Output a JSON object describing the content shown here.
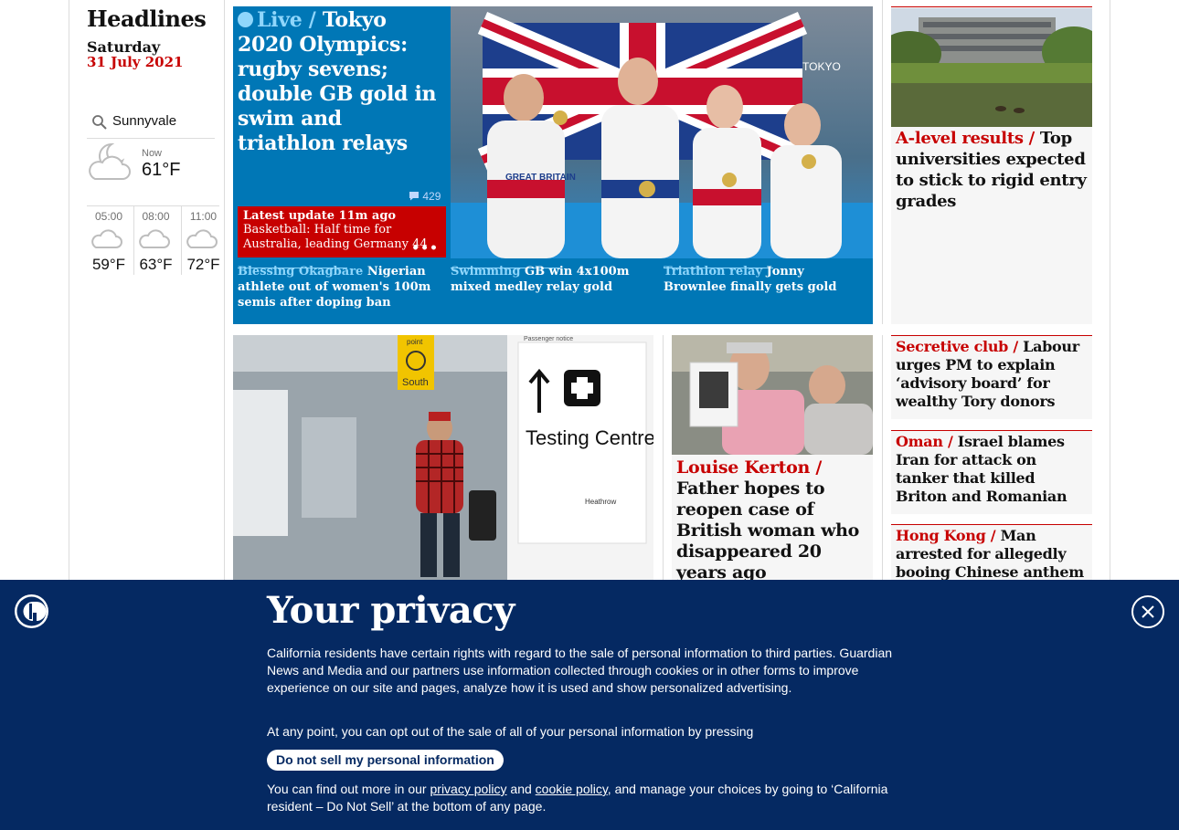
{
  "sidebar": {
    "title": "Headlines",
    "day": "Saturday",
    "date": "31 July 2021",
    "weather": {
      "location": "Sunnyvale",
      "now_label": "Now",
      "now_temp": "61°F",
      "forecast": [
        {
          "time": "05:00",
          "temp": "59°F",
          "icon": "cloud-icon"
        },
        {
          "time": "08:00",
          "temp": "63°F",
          "icon": "cloud-icon"
        },
        {
          "time": "11:00",
          "temp": "72°F",
          "icon": "cloud-icon"
        }
      ]
    }
  },
  "live": {
    "kicker": "Live /",
    "headline": "Tokyo 2020 Olympics: rugby sevens; double GB gold in swim and triathlon relays",
    "comments": "429",
    "latest_label": "Latest update 11m ago",
    "latest_text": "Basketball: Half time for Australia, leading Germany 44",
    "subs": [
      {
        "kicker": "Blessing Okagbare",
        "text": "Nigerian athlete out of women's 100m semis after doping ban"
      },
      {
        "kicker": "Swimming",
        "text": "GB win 4x100m mixed medley relay gold"
      },
      {
        "kicker": "Triathlon relay",
        "text": "Jonny Brownlee finally gets gold"
      }
    ],
    "image_text": {
      "flag_caption": "GREAT BRITAIN",
      "sign": "TOKYO"
    }
  },
  "right": {
    "alevel": {
      "kicker": "A-level results /",
      "headline": "Top universities expected to stick to rigid entry grades"
    },
    "cards": [
      {
        "kicker": "Secretive club /",
        "headline": "Labour urges PM to explain ‘advisory board’ for wealthy Tory donors"
      },
      {
        "kicker": "Oman /",
        "headline": "Israel blames Iran for attack on tanker that killed Briton and Romanian"
      },
      {
        "kicker": "Hong Kong /",
        "headline": "Man arrested for allegedly booing Chinese anthem while"
      }
    ]
  },
  "middle": {
    "travel_image_text": {
      "sign1": "Testing Centre",
      "sign2": "South",
      "sign3": "point",
      "sign4": "Heathrow",
      "sign5": "Passenger notice"
    },
    "kerton": {
      "kicker": "Louise Kerton /",
      "headline": "Father hopes to reopen case of British woman who disappeared 20 years ago"
    }
  },
  "privacy": {
    "title": "Your privacy",
    "p1": "California residents have certain rights with regard to the sale of personal information to third parties. Guardian News and Media and our partners use information collected through cookies or in other forms to improve experience on our site and pages, analyze how it is used and show personalized advertising.",
    "p2": "At any point, you can opt out of the sale of all of your personal information by pressing",
    "button": "Do not sell my personal information",
    "p3_start": "You can find out more in our",
    "privacy_link": "privacy policy",
    "and": "and",
    "cookie_link": "cookie policy",
    "p3_end": ", and manage your choices by going to ‘California resident – Do Not Sell’ at the bottom of any page."
  },
  "colors": {
    "brand_blue": "#052962",
    "live_blue": "#0077b6",
    "news_red": "#c70000"
  }
}
